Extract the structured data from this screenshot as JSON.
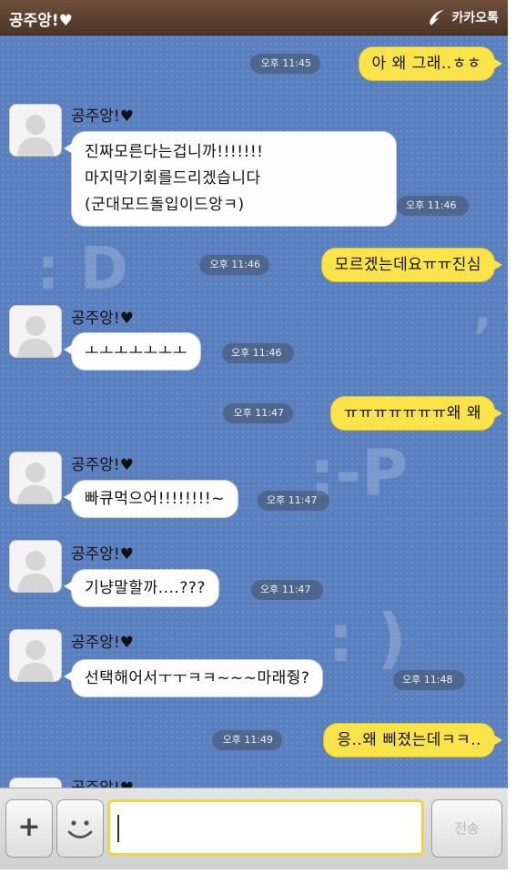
{
  "header": {
    "chat_title": "공주앙!♥",
    "app_name": "카카오톡"
  },
  "messages": [
    {
      "side": "me",
      "text": "아 왜 그래..ㅎㅎ",
      "time": "오후 11:45"
    },
    {
      "side": "them",
      "sender": "공주앙!♥",
      "lines": [
        "진짜모른다는겁니까!!!!!!!",
        "마지막기회를드리겠습니다",
        "(군대모드돌입이드앙ㅋ)"
      ],
      "time": "오후 11:46"
    },
    {
      "side": "me",
      "text": "모르겠는데요ㅠㅠ진심",
      "time": "오후 11:46"
    },
    {
      "side": "them",
      "sender": "공주앙!♥",
      "text": "ㅗㅗㅗㅗㅗㅗㅗ",
      "time": "오후 11:46"
    },
    {
      "side": "me",
      "text": "ㅠㅠㅠㅠㅠㅠㅠ왜 왜",
      "time": "오후 11:47"
    },
    {
      "side": "them",
      "sender": "공주앙!♥",
      "text": "빠큐먹으어!!!!!!!!~",
      "time": "오후 11:47"
    },
    {
      "side": "them",
      "sender": "공주앙!♥",
      "text": "기냥말할까....???",
      "time": "오후 11:47"
    },
    {
      "side": "them",
      "sender": "공주앙!♥",
      "text": "선택해어서ㅜㅜㅋㅋ~~~마래줭?",
      "time": "오후 11:48"
    },
    {
      "side": "me",
      "text": "응..왜 삐졌는데ㅋㅋ..",
      "time": "오후 11:49"
    },
    {
      "side": "them",
      "sender": "공주앙!♥",
      "text": "",
      "time": ""
    }
  ],
  "input_bar": {
    "plus_label": "+",
    "message_value": "",
    "send_label": "전송"
  },
  "icons": [
    "kakao-logo-icon",
    "default-avatar-icon",
    "smile-icon",
    "plus-icon"
  ],
  "colors": {
    "chat_background": "#5a7fbf",
    "my_bubble": "#fbe44a",
    "their_bubble": "#fdfdfd",
    "header": "#5b402e",
    "input_border": "#f1d24c"
  }
}
